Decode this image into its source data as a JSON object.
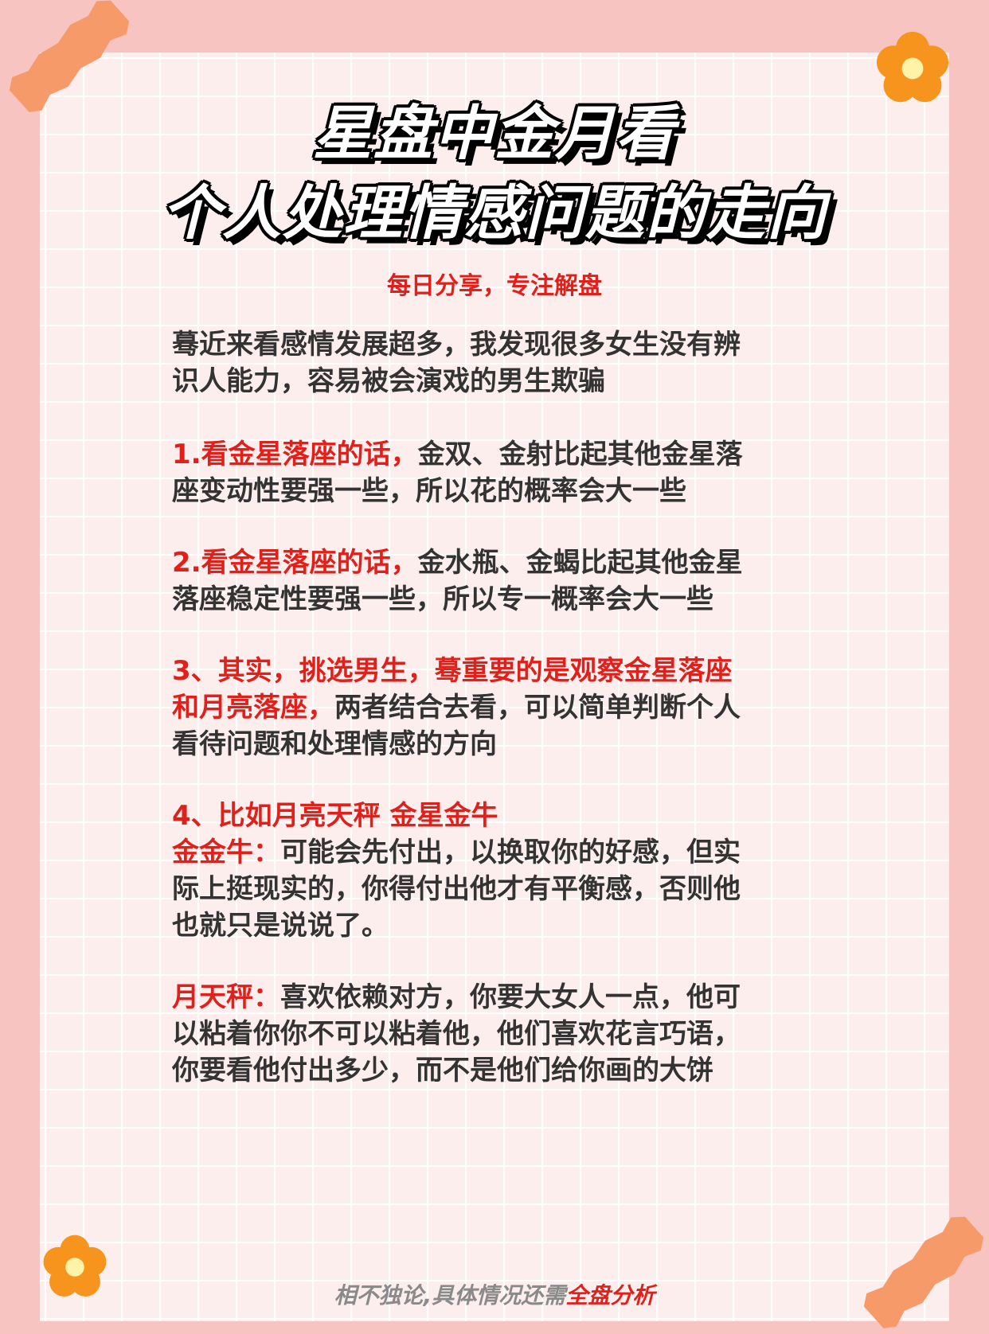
{
  "title": {
    "line1": "星盘中金月看",
    "line2": "个人处理情感问题的走向"
  },
  "subtitle": "每日分享，专注解盘",
  "intro": {
    "line1": "蓦近来看感情发展超多，我发现很多女生没有辨",
    "line2": "识人能力，容易被会演戏的男生欺骗"
  },
  "points": {
    "p1": {
      "highlight": "1.看金星落座的话，",
      "line1_rest": "金双、金射比起其他金星落",
      "line2": "座变动性要强一些，所以花的概率会大一些"
    },
    "p2": {
      "highlight": "2.看金星落座的话，",
      "line1_rest": "金水瓶、金蝎比起其他金星",
      "line2": "落座稳定性要强一些，所以专一概率会大一些"
    },
    "p3": {
      "highlight1": "3、其实，挑选男生，蓦重要的是观察金星落座",
      "highlight2": "和月亮落座，",
      "line2_rest": "两者结合去看，可以简单判断个人",
      "line3": "看待问题和处理情感的方向"
    },
    "p4": {
      "heading": "4、比如月亮天秤 金星金牛",
      "label": "金金牛：",
      "line1_rest": "可能会先付出，以换取你的好感，但实",
      "line2": "际上挺现实的，你得付出他才有平衡感，否则他",
      "line3": "也就只是说说了。"
    },
    "p5": {
      "label": "月天秤：",
      "line1_rest": "喜欢依赖对方，你要大女人一点，他可",
      "line2": "以粘着你你不可以粘着他，他们喜欢花言巧语，",
      "line3": "你要看他付出多少，而不是他们给你画的大饼"
    }
  },
  "footer": {
    "plain": "相不独论,具体情况还需",
    "highlight": "全盘分析"
  },
  "colors": {
    "background": "#f7c4c2",
    "card": "#fdeeee",
    "accent_red": "#e0201b",
    "tape": "#f79a6a",
    "flower": "#f7941d",
    "flower_center": "#fff3a8"
  },
  "icons": [
    "flower-icon",
    "tape-decoration"
  ]
}
